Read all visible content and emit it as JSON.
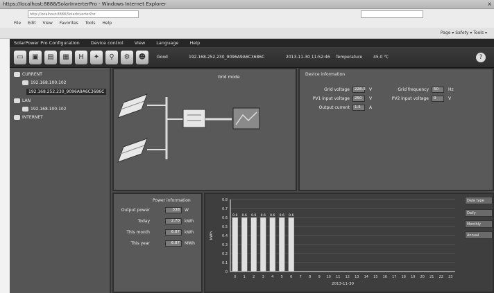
{
  "browser": {
    "title": "https://localhost:8888/SolarInverterPro - Windows Internet Explorer",
    "close": "x",
    "address": "http://localhost:8888/SolarInverterPro",
    "menu": [
      "File",
      "Edit",
      "View",
      "Favorites",
      "Tools",
      "Help"
    ],
    "fav_right": "Page ▾  Safety ▾  Tools ▾"
  },
  "app": {
    "menu": [
      "SolarPower Pro Configuration",
      "Device control",
      "View",
      "Language",
      "Help"
    ],
    "toolbar": {
      "icons": [
        "monitor-icon",
        "device-icon",
        "document-icon",
        "record-icon",
        "history-icon",
        "network-icon",
        "search-icon",
        "settings-icon",
        "user-icon"
      ],
      "status_label": "Good",
      "device": "192.168.252.230_9096A9A6C3686C",
      "datetime": "2013-11-30 11:52:46",
      "temp_label": "Temperature",
      "temp_value": "45.0 ℃"
    },
    "tree": {
      "items": [
        {
          "label": "CURRENT"
        },
        {
          "label": "192.168.100.102"
        },
        {
          "label": "192.168.252.230_9096A9A6C3686C"
        },
        {
          "label": "LAN"
        },
        {
          "label": "192.168.100.102"
        },
        {
          "label": "INTERNET"
        }
      ]
    },
    "flow": {
      "mode": "Grid mode"
    },
    "params": {
      "title": "Device information",
      "left": [
        {
          "label": "Grid voltage",
          "value": "228.3",
          "unit": "V"
        },
        {
          "label": "PV1 input voltage",
          "value": "250",
          "unit": "V"
        },
        {
          "label": "Output current",
          "value": "1.5",
          "unit": "A"
        }
      ],
      "right": [
        {
          "label": "Grid frequency",
          "value": "50",
          "unit": "Hz"
        },
        {
          "label": "PV2 input voltage",
          "value": "0",
          "unit": "V"
        }
      ]
    },
    "energy": {
      "title": "Power information",
      "rows": [
        {
          "label": "Output power",
          "value": "338",
          "unit": "W"
        },
        {
          "label": "Today",
          "value": "2.70",
          "unit": "kWh"
        },
        {
          "label": "This month",
          "value": "6.87",
          "unit": "kWh"
        },
        {
          "label": "This year",
          "value": "6.87",
          "unit": "MWh"
        }
      ]
    },
    "chart_side": {
      "header": "Date type",
      "options": [
        "Daily",
        "Monthly",
        "Annual"
      ]
    },
    "chart_data": {
      "type": "bar",
      "categories": [
        "0",
        "1",
        "2",
        "3",
        "4",
        "5",
        "6",
        "7",
        "8",
        "9",
        "10",
        "11",
        "12",
        "13",
        "14",
        "15",
        "16",
        "17",
        "18",
        "19",
        "20",
        "21",
        "22",
        "23"
      ],
      "values": [
        0.6,
        0.6,
        0.6,
        0.6,
        0.6,
        0.6,
        0.6,
        0,
        0,
        0,
        0,
        0,
        0,
        0,
        0,
        0,
        0,
        0,
        0,
        0,
        0,
        0,
        0,
        0
      ],
      "data_labels": [
        "0.6",
        "0.6",
        "0.6",
        "0.6",
        "0.6",
        "0.6",
        "0.6",
        "",
        "",
        "",
        "",
        "",
        "",
        "",
        "",
        "",
        "",
        "",
        "",
        "",
        "",
        "",
        "",
        ""
      ],
      "ylabel": "kWh",
      "yticks": [
        "0",
        "0.1",
        "0.2",
        "0.3",
        "0.4",
        "0.5",
        "0.6",
        "0.7",
        "0.8"
      ],
      "ylim": [
        0,
        0.8
      ],
      "xlabel": "2013-11-30",
      "grid": true,
      "color": "#e0e0e0"
    }
  }
}
